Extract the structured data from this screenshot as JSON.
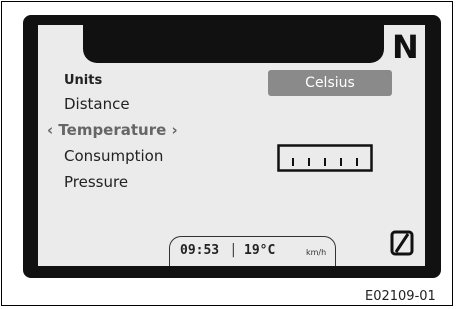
{
  "gear": "N",
  "menu": {
    "heading": "Units",
    "items": [
      {
        "label": "Distance"
      },
      {
        "label": "‹ Temperature ›"
      },
      {
        "label": "Consumption"
      },
      {
        "label": "Pressure"
      }
    ]
  },
  "value_box": "Celsius",
  "status": {
    "time": "09:53",
    "separator": "|",
    "temperature": "19°C",
    "speed_unit": "km/h"
  },
  "caption": "E02109-01",
  "icons": {
    "gauge": "scale-gauge-icon",
    "reset": "slashed-zero-icon"
  },
  "colors": {
    "screen_bg": "#ebebeb",
    "bezel": "#111111",
    "value_box_bg": "#8a8a8a"
  }
}
